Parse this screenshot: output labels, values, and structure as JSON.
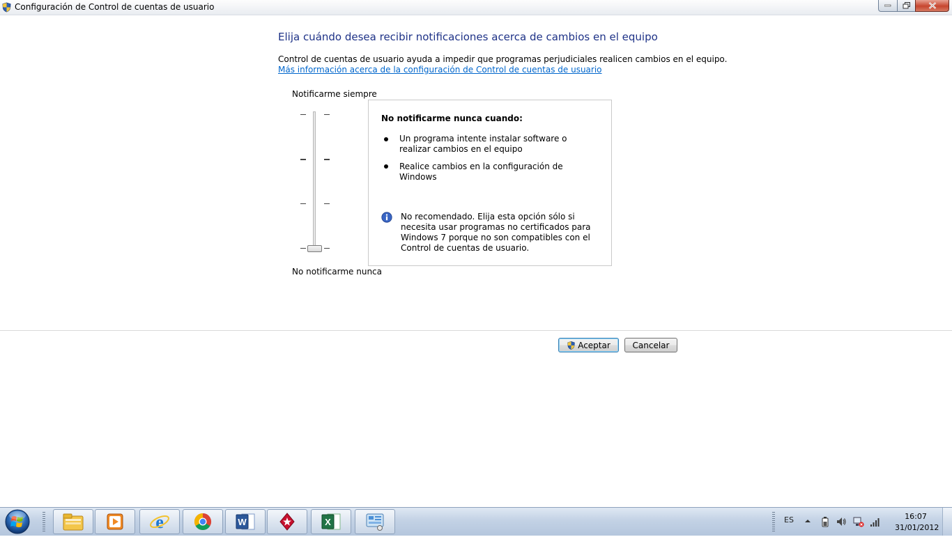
{
  "window": {
    "title": "Configuración de Control de cuentas de usuario",
    "controls": [
      "minimize-icon",
      "maximize-icon",
      "close-icon"
    ]
  },
  "main": {
    "heading": "Elija cuándo desea recibir notificaciones acerca de cambios en el equipo",
    "description": "Control de cuentas de usuario ayuda a impedir que programas perjudiciales realicen cambios en el equipo.",
    "more_info_link": "Más información acerca de la configuración de Control de cuentas de usuario"
  },
  "slider": {
    "label_top": "Notificarme siempre",
    "label_bottom": "No notificarme nunca",
    "levels": 4,
    "selected_level": 1
  },
  "info": {
    "title": "No notificarme nunca cuando:",
    "items": [
      "Un programa intente instalar software o realizar cambios en el equipo",
      "Realice cambios en la configuración de Windows"
    ],
    "warning": "No recomendado. Elija esta opción sólo si necesita usar programas no certificados para Windows 7 porque no son compatibles con el Control de cuentas de usuario."
  },
  "buttons": {
    "ok": "Aceptar",
    "cancel": "Cancelar"
  },
  "taskbar": {
    "pinned": [
      "explorer-icon",
      "media-player-icon",
      "internet-explorer-icon",
      "chrome-icon",
      "word-icon",
      "pokerstars-icon",
      "excel-icon",
      "control-panel-icon"
    ],
    "language": "ES",
    "time": "16:07",
    "date": "31/01/2012"
  },
  "colors": {
    "heading": "#1e3287",
    "link": "#0066cc",
    "ok_border": "#3c7fb1"
  }
}
